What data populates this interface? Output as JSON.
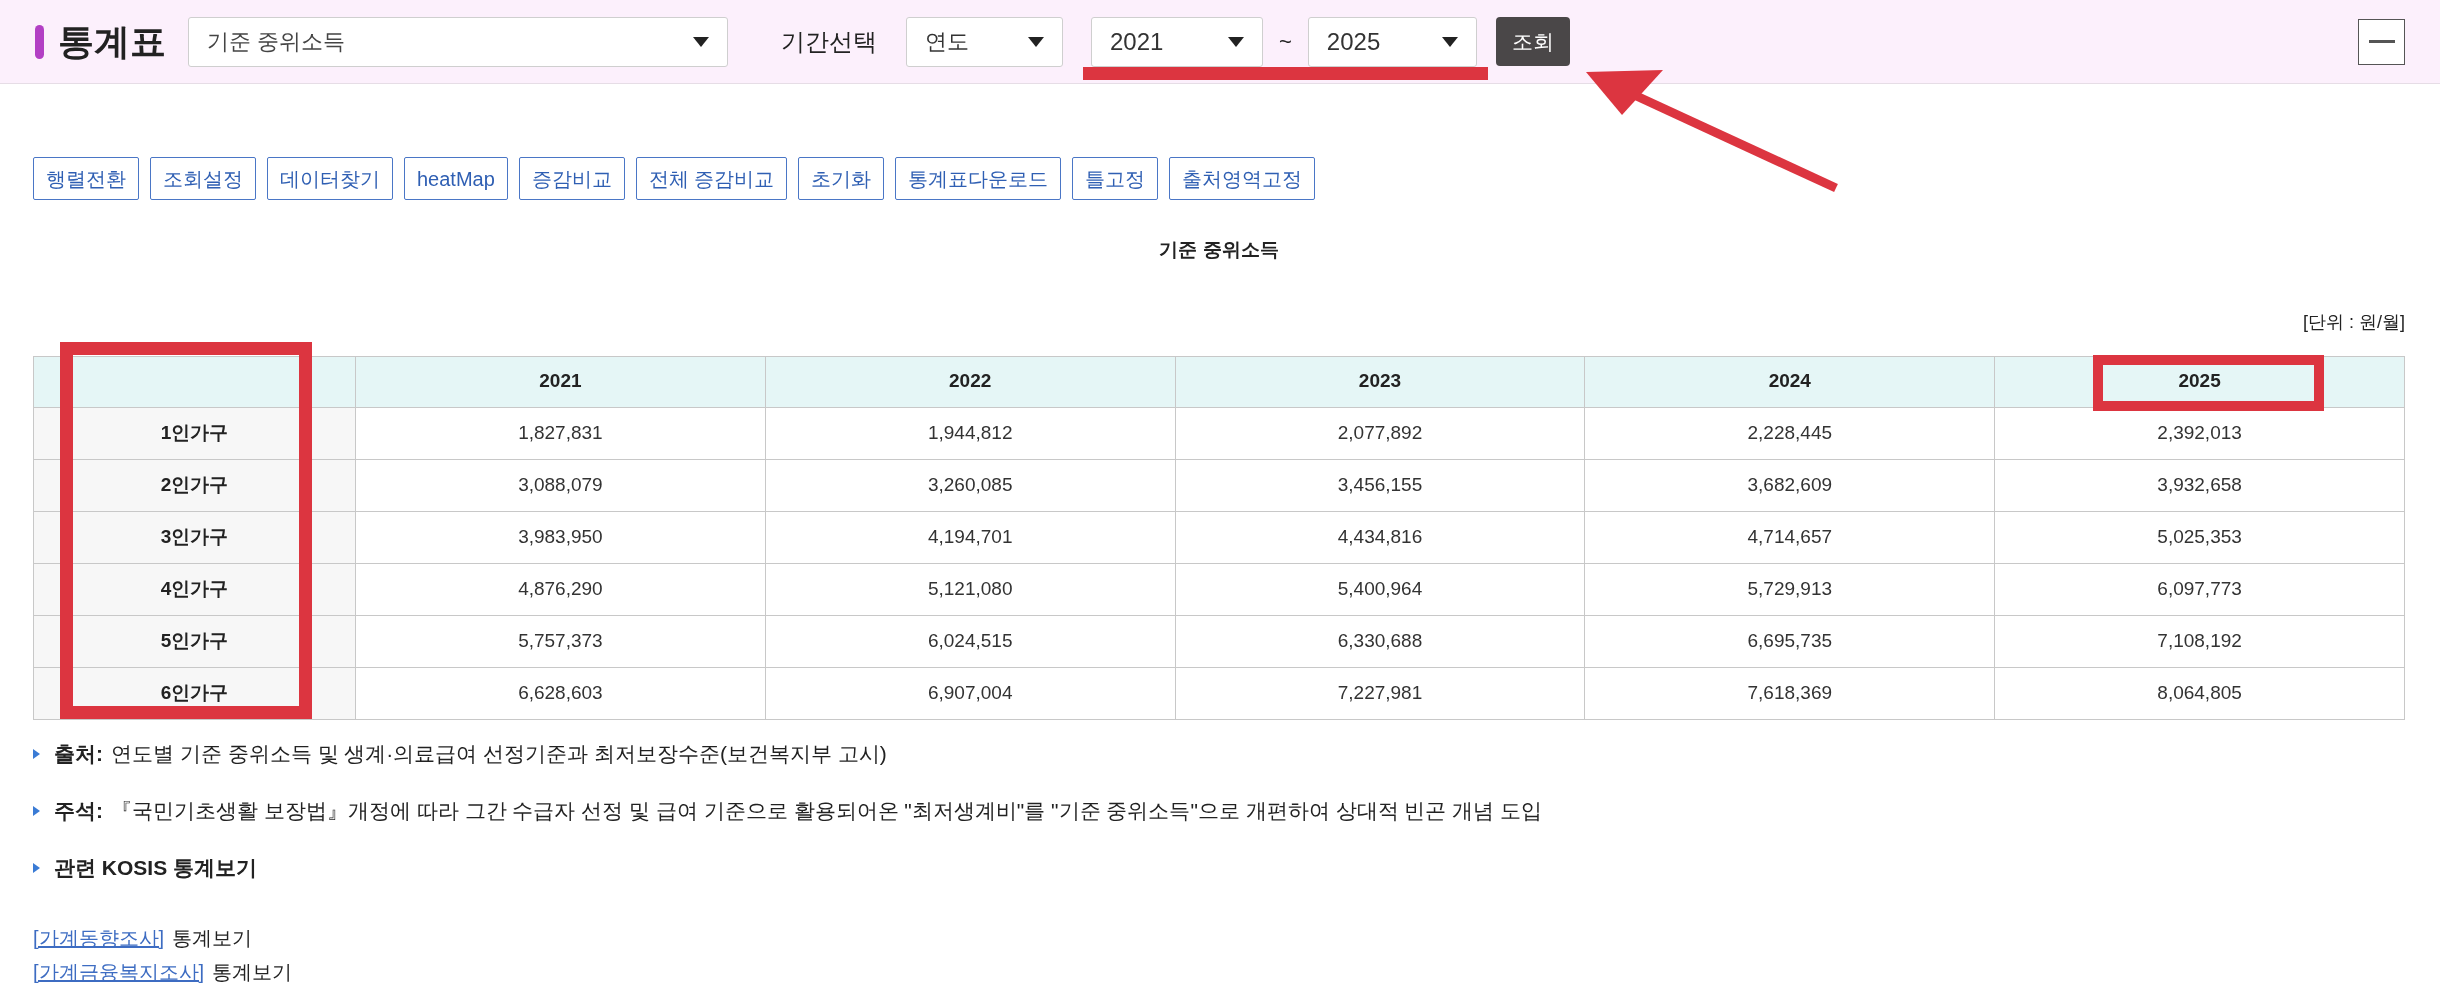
{
  "header": {
    "title": "통계표",
    "table_select": {
      "value": "기준 중위소득"
    },
    "period_label": "기간선택",
    "period_type": {
      "value": "연도"
    },
    "from_year": {
      "value": "2021"
    },
    "separator": "~",
    "to_year": {
      "value": "2025"
    },
    "search_button": "조회"
  },
  "toolbar": [
    "행렬전환",
    "조회설정",
    "데이터찾기",
    "heatMap",
    "증감비교",
    "전체 증감비교",
    "초기화",
    "통계표다운로드",
    "틀고정",
    "출처영역고정"
  ],
  "table_title": "기준 중위소득",
  "unit": "[단위 : 원/월]",
  "table": {
    "columns": [
      "2021",
      "2022",
      "2023",
      "2024",
      "2025"
    ],
    "rows": [
      {
        "label": "1인가구",
        "values": [
          "1,827,831",
          "1,944,812",
          "2,077,892",
          "2,228,445",
          "2,392,013"
        ]
      },
      {
        "label": "2인가구",
        "values": [
          "3,088,079",
          "3,260,085",
          "3,456,155",
          "3,682,609",
          "3,932,658"
        ]
      },
      {
        "label": "3인가구",
        "values": [
          "3,983,950",
          "4,194,701",
          "4,434,816",
          "4,714,657",
          "5,025,353"
        ]
      },
      {
        "label": "4인가구",
        "values": [
          "4,876,290",
          "5,121,080",
          "5,400,964",
          "5,729,913",
          "6,097,773"
        ]
      },
      {
        "label": "5인가구",
        "values": [
          "5,757,373",
          "6,024,515",
          "6,330,688",
          "6,695,735",
          "7,108,192"
        ]
      },
      {
        "label": "6인가구",
        "values": [
          "6,628,603",
          "6,907,004",
          "7,227,981",
          "7,618,369",
          "8,064,805"
        ]
      }
    ]
  },
  "notes": [
    {
      "label": "출처:",
      "text": "연도별 기준 중위소득 및 생계·의료급여 선정기준과 최저보장수준(보건복지부 고시)"
    },
    {
      "label": "주석:",
      "text": "『국민기초생활 보장법』개정에 따라 그간 수급자 선정 및 급여 기준으로 활용되어온 \"최저생계비\"를 \"기준 중위소득\"으로 개편하여 상대적 빈곤 개념 도입"
    },
    {
      "label": "관련 KOSIS 통계보기"
    }
  ],
  "related_links": [
    {
      "link": "[가계동향조사]",
      "text": "통계보기"
    },
    {
      "link": "[가계금융복지조사]",
      "text": "통계보기"
    }
  ]
}
